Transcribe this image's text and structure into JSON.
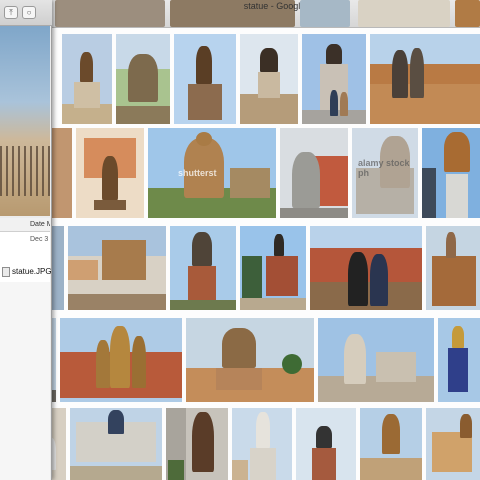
{
  "browser": {
    "window_title": "statue - Google Search"
  },
  "finder": {
    "date_column_header": "Date M",
    "date_value": "Dec 3",
    "file_name": "statue.JPG"
  },
  "results": {
    "watermark_1": "shutterst",
    "watermark_2": "alamy stock ph"
  },
  "colors": {
    "sky_blue": "#8fb6dd",
    "sand": "#c9a76f",
    "bronze": "#6b4a2b",
    "red_rock": "#b5563a"
  }
}
